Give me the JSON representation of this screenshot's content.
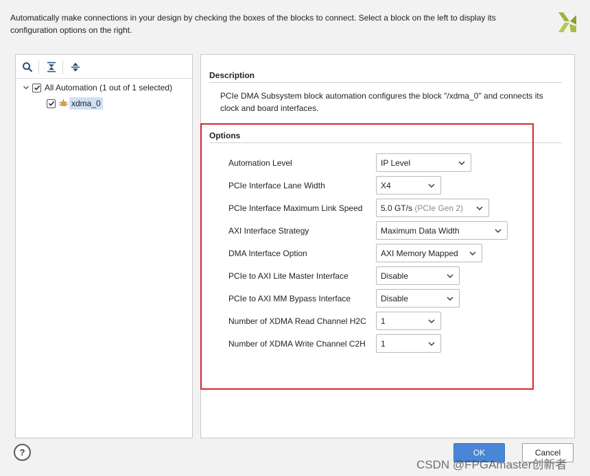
{
  "intro_text": "Automatically make connections in your design by checking the boxes of the blocks to connect. Select a block on the left to display its configuration options on the right.",
  "logo": {
    "icon": "xilinx-logo-icon",
    "color": "#9db43a"
  },
  "tree": {
    "toolbar": {
      "search": "search-icon",
      "collapse_all": "collapse-all-icon",
      "expand_all": "expand-all-icon"
    },
    "root": {
      "label": "All Automation (1 out of 1 selected)",
      "checked": true,
      "expanded": true
    },
    "child": {
      "label": "xdma_0",
      "checked": true,
      "icon": "ip-block-icon",
      "selected": true
    }
  },
  "description": {
    "title": "Description",
    "text": "PCIe DMA Subsystem block automation configures the block \"/xdma_0\" and connects its clock and board interfaces."
  },
  "options": {
    "title": "Options",
    "items": [
      {
        "label": "Automation Level",
        "value": "IP Level",
        "hint": ""
      },
      {
        "label": "PCIe Interface Lane Width",
        "value": "X4",
        "hint": ""
      },
      {
        "label": "PCIe Interface Maximum Link Speed",
        "value": "5.0 GT/s",
        "hint": "(PCIe Gen 2)"
      },
      {
        "label": "AXI Interface Strategy",
        "value": "Maximum Data Width",
        "hint": ""
      },
      {
        "label": "DMA Interface Option",
        "value": "AXI Memory Mapped",
        "hint": ""
      },
      {
        "label": "PCIe to AXI Lite Master Interface",
        "value": "Disable",
        "hint": ""
      },
      {
        "label": "PCIe to AXI MM Bypass Interface",
        "value": "Disable",
        "hint": ""
      },
      {
        "label": "Number of XDMA Read Channel H2C",
        "value": "1",
        "hint": ""
      },
      {
        "label": "Number of XDMA Write Channel C2H",
        "value": "1",
        "hint": ""
      }
    ]
  },
  "footer": {
    "help": "?",
    "ok": "OK",
    "cancel": "Cancel"
  },
  "watermark": "CSDN @FPGAmaster创新者",
  "colors": {
    "accent": "#4a86d6",
    "highlight": "#d9252c",
    "selection": "#cfe0f5"
  }
}
